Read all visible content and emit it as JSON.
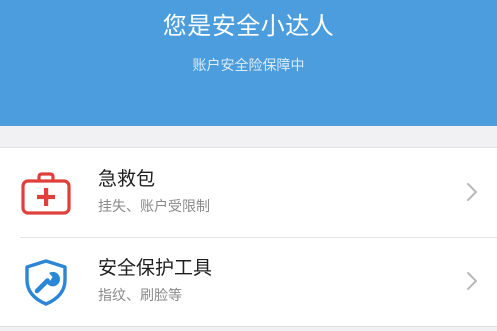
{
  "header": {
    "title": "您是安全小达人",
    "subtitle": "账户安全险保障中"
  },
  "colors": {
    "header_bg": "#4c9ddd",
    "first_aid_icon": "#e0403a",
    "shield_icon": "#2b86d8"
  },
  "items": [
    {
      "title": "急救包",
      "subtitle": "挂失、账户受限制",
      "icon": "first-aid-kit-icon"
    },
    {
      "title": "安全保护工具",
      "subtitle": "指纹、刷脸等",
      "icon": "shield-wrench-icon"
    }
  ]
}
